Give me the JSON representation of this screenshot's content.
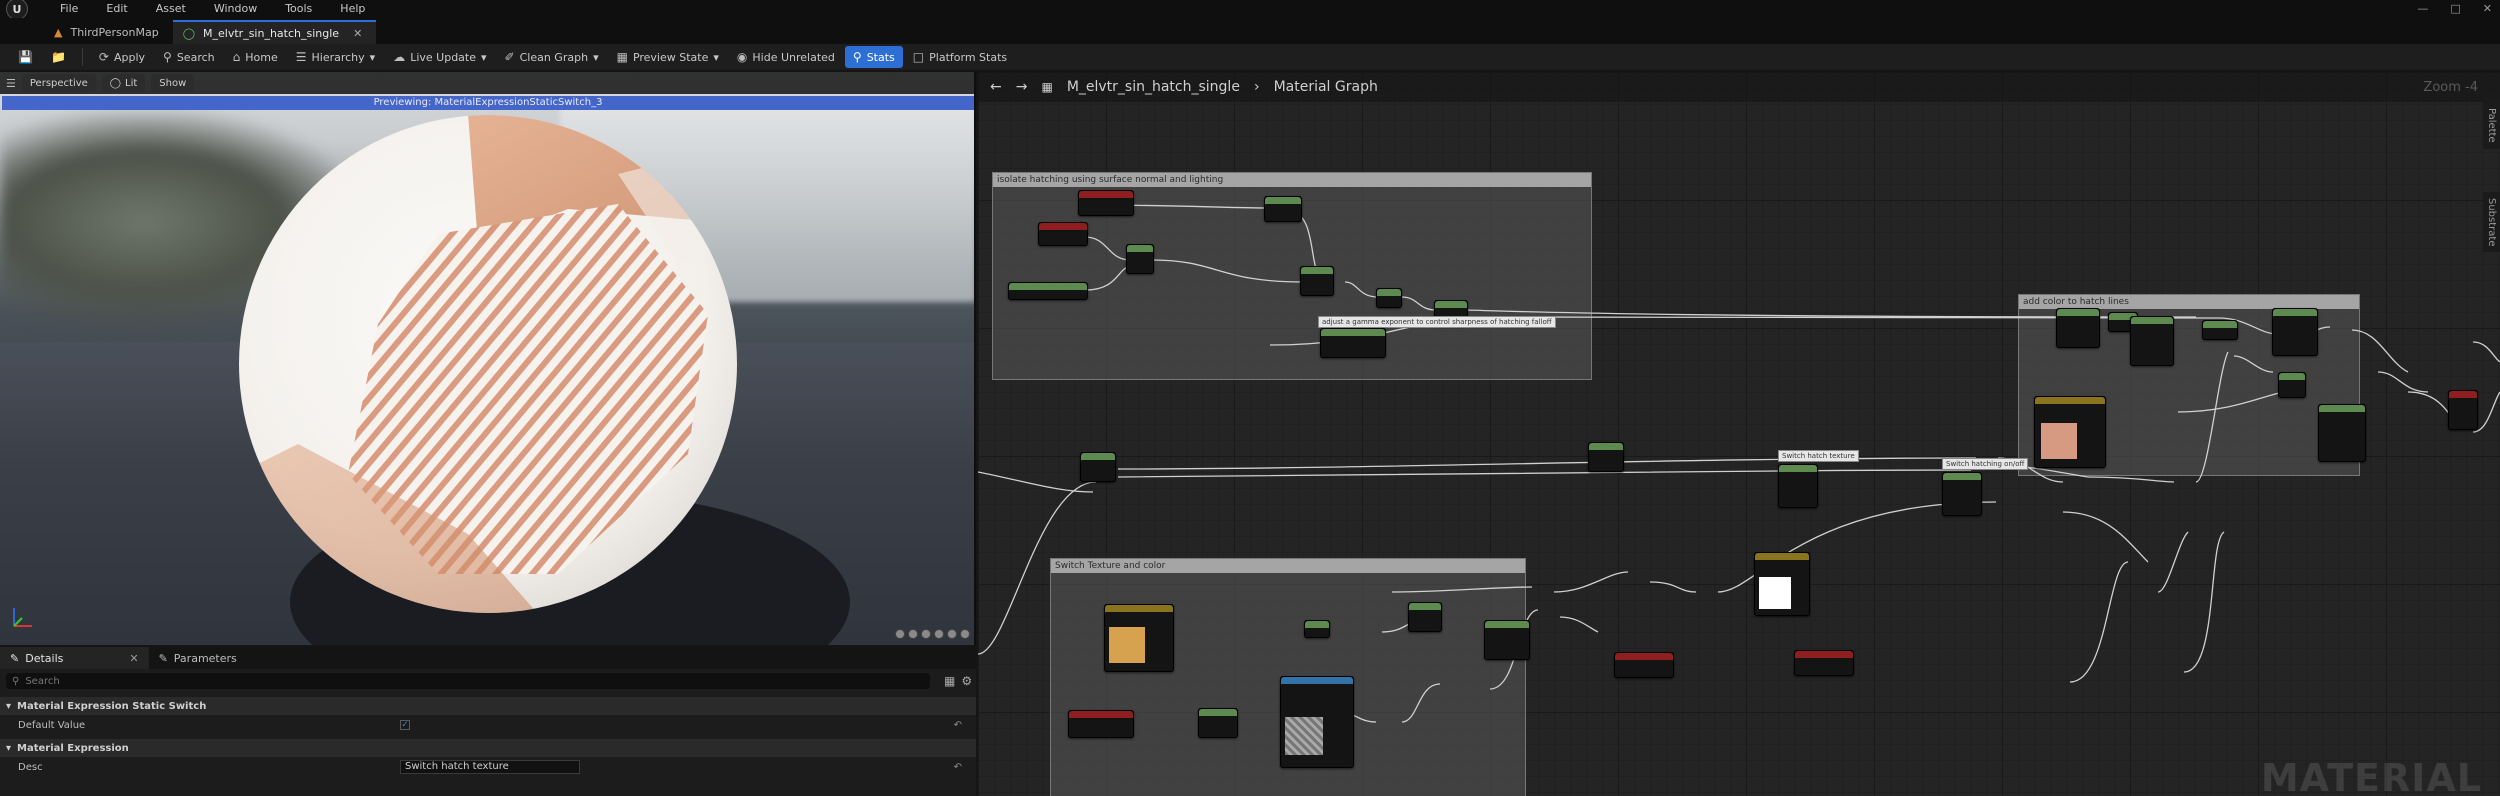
{
  "menu": {
    "items": [
      "File",
      "Edit",
      "Asset",
      "Window",
      "Tools",
      "Help"
    ]
  },
  "tabs": [
    {
      "label": "ThirdPersonMap",
      "active": false
    },
    {
      "label": "M_elvtr_sin_hatch_single",
      "active": true
    }
  ],
  "toolbar": {
    "buttons": [
      "Apply",
      "Search",
      "Home",
      "Hierarchy",
      "Live Update",
      "Clean Graph",
      "Preview State",
      "Hide Unrelated",
      "Stats",
      "Platform Stats"
    ]
  },
  "viewport": {
    "buttons": [
      "Perspective",
      "Lit",
      "Show"
    ],
    "banner": "Previewing: MaterialExpressionStaticSwitch_3"
  },
  "details": {
    "tabs": [
      "Details",
      "Parameters"
    ],
    "search_placeholder": "Search",
    "section1": "Material Expression Static Switch",
    "default_value_label": "Default Value",
    "section2": "Material Expression",
    "desc_label": "Desc",
    "desc_value": "Switch hatch texture"
  },
  "graph": {
    "asset_name": "M_elvtr_sin_hatch_single",
    "graph_name": "Material Graph",
    "zoom": "Zoom -4",
    "watermark": "MATERIAL",
    "side_tabs": [
      "Palette",
      "Substrate"
    ],
    "comments": [
      "isolate hatching using surface normal and lighting",
      "add color to hatch lines",
      "Switch Texture and color"
    ],
    "notes": [
      "Switch hatch texture",
      "Switch hatching on/off"
    ]
  },
  "colors": {
    "accent": "#2e6fd6",
    "banner": "#4466c8",
    "node_green": "#5d8a4f",
    "node_red": "#8f1e1e",
    "node_yellow": "#8a7420",
    "node_blue": "#3572a8"
  }
}
